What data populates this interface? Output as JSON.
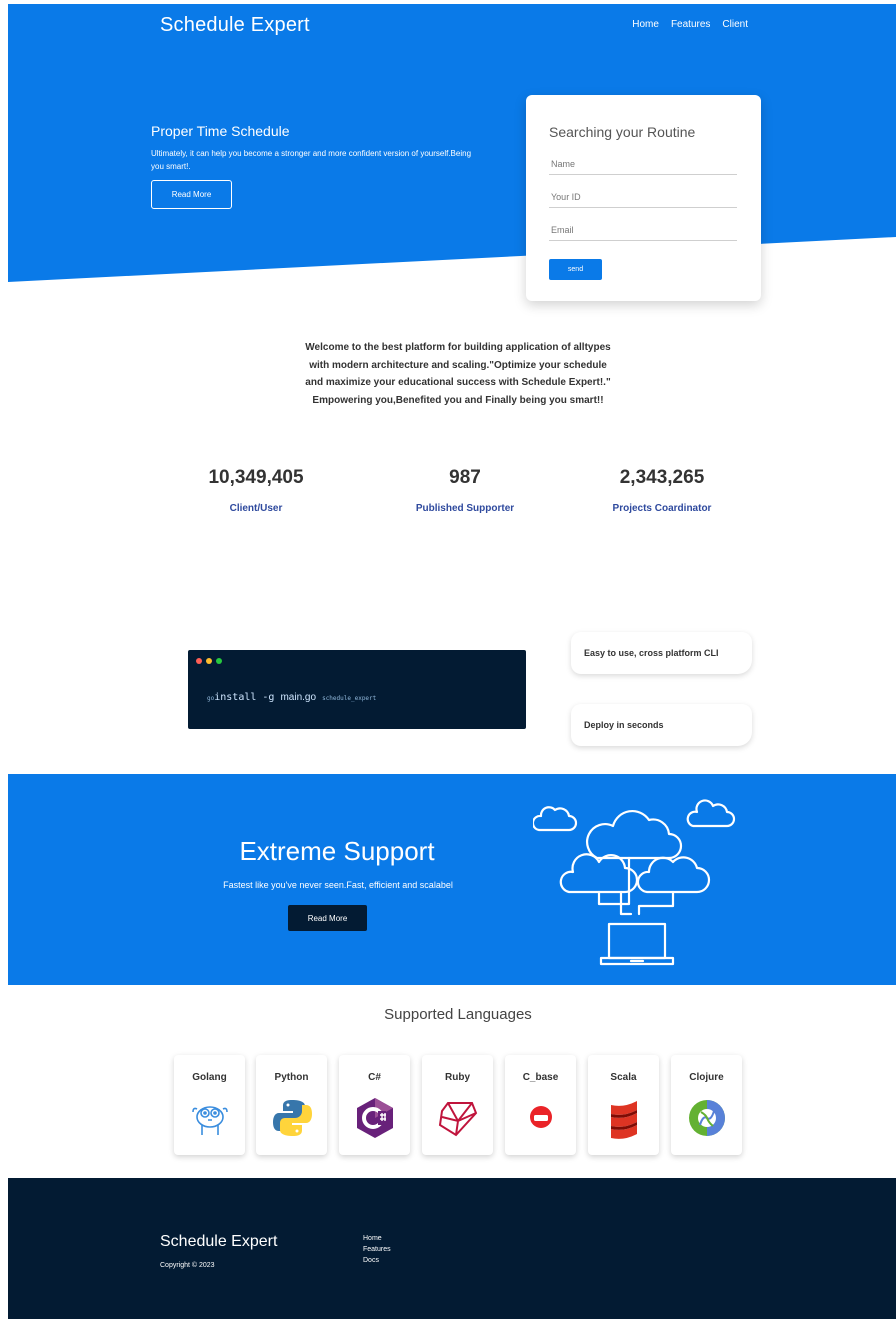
{
  "header": {
    "brand": "Schedule Expert",
    "nav": [
      "Home",
      "Features",
      "Client"
    ]
  },
  "hero": {
    "title": "Proper Time Schedule",
    "text": "Ultimately, it can help you become a stronger and more confident version of yourself.Being you smart!.",
    "button": "Read More"
  },
  "form": {
    "title": "Searching your Routine",
    "fields": [
      "Name",
      "Your ID",
      "Email"
    ],
    "button": "send"
  },
  "welcome": "Welcome to the best platform for building application of alltypes with modern architecture and scaling.\"Optimize your schedule and maximize your educational success with Schedule Expert!.\" Empowering you,Benefited you and Finally being you smart!!",
  "stats": [
    {
      "value": "10,349,405",
      "label": "Client/User"
    },
    {
      "value": "987",
      "label": "Published Supporter"
    },
    {
      "value": "2,343,265",
      "label": "Projects Coardinator"
    }
  ],
  "terminal": {
    "prefix": "go",
    "command": "install -g ",
    "file": "main.go",
    "arg": "schedule_expert",
    "dot_colors": [
      "#ff5f56",
      "#ffbd2e",
      "#27c93f"
    ]
  },
  "features": [
    "Easy to use, cross platform CLI",
    "Deploy in seconds"
  ],
  "support": {
    "title": "Extreme Support",
    "text": "Fastest like you've never seen.Fast, efficient and scalabel",
    "button": "Read More"
  },
  "languages": {
    "title": "Supported Languages",
    "items": [
      {
        "name": "Golang",
        "icon": "gopher-icon"
      },
      {
        "name": "Python",
        "icon": "python-icon"
      },
      {
        "name": "C#",
        "icon": "csharp-icon"
      },
      {
        "name": "Ruby",
        "icon": "ruby-icon"
      },
      {
        "name": "C_base",
        "icon": "couchbase-icon"
      },
      {
        "name": "Scala",
        "icon": "scala-icon"
      },
      {
        "name": "Clojure",
        "icon": "clojure-icon"
      }
    ]
  },
  "footer": {
    "brand": "Schedule Expert",
    "copyright": "Copyright © 2023",
    "links": [
      "Home",
      "Features",
      "Docs"
    ]
  },
  "colors": {
    "primary": "#0a7ae8",
    "dark": "#031b33",
    "stat_label": "#2f4a9e"
  }
}
